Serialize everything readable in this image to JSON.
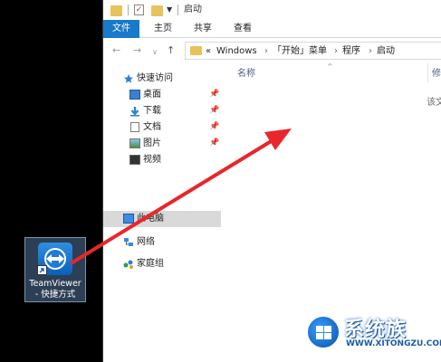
{
  "window": {
    "title": "启动"
  },
  "ribbon": {
    "tabs": [
      {
        "label": "文件",
        "active": true
      },
      {
        "label": "主页"
      },
      {
        "label": "共享"
      },
      {
        "label": "查看"
      }
    ]
  },
  "address_bar": {
    "overflow": "«",
    "crumbs": [
      "Windows",
      "「开始」菜单",
      "程序",
      "启动"
    ],
    "separator": "›"
  },
  "sidebar": {
    "quick_access": {
      "label": "快速访问"
    },
    "pinned": [
      {
        "label": "桌面",
        "icon": "desktop-icon"
      },
      {
        "label": "下载",
        "icon": "download-icon"
      },
      {
        "label": "文档",
        "icon": "document-icon"
      },
      {
        "label": "图片",
        "icon": "pictures-icon"
      }
    ],
    "videos": {
      "label": "视频",
      "icon": "video-icon"
    },
    "this_pc": {
      "label": "此电脑",
      "icon": "computer-icon"
    },
    "network": {
      "label": "网络",
      "icon": "network-icon"
    },
    "homegroup": {
      "label": "家庭组",
      "icon": "homegroup-icon"
    }
  },
  "content": {
    "columns": {
      "name": "名称",
      "modified": "修"
    },
    "empty_message": "该文"
  },
  "desktop": {
    "shortcut": {
      "line1": "TeamViewer",
      "line2": "- 快捷方式"
    }
  },
  "watermark": {
    "brand": "系统族",
    "url": "WWW.XITONGZU.COM"
  },
  "colors": {
    "accent": "#1979ca",
    "arrow": "#e8262b",
    "selected_row": "#d9d9d9"
  }
}
